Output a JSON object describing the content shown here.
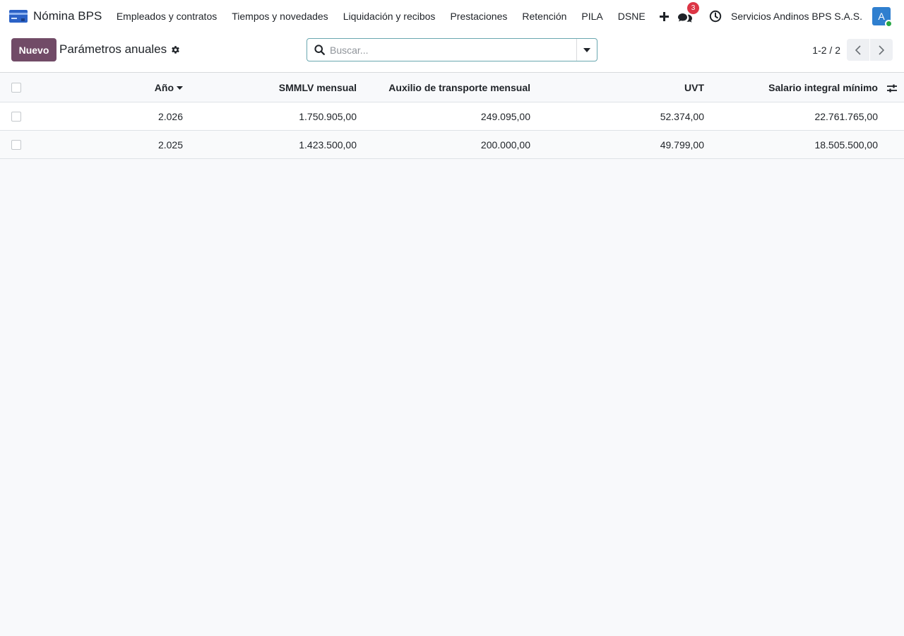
{
  "navbar": {
    "app_name": "Nómina BPS",
    "app_icon": "app-card-icon",
    "menu": [
      {
        "label": "Empleados y contratos"
      },
      {
        "label": "Tiempos y novedades"
      },
      {
        "label": "Liquidación y recibos"
      },
      {
        "label": "Prestaciones"
      },
      {
        "label": "Retención"
      },
      {
        "label": "PILA"
      },
      {
        "label": "DSNE"
      }
    ],
    "plus_icon": "plus-icon",
    "chat_icon": "chat-bubbles-icon",
    "chat_badge": "3",
    "clock_icon": "clock-icon",
    "company": "Servicios Andinos BPS S.A.S.",
    "avatar_initial": "A",
    "avatar_color": "#2f7fcf",
    "presence_color": "#28a745"
  },
  "control": {
    "new_label": "Nuevo",
    "new_color": "#714b67",
    "title": "Parámetros anuales",
    "search_placeholder": "Buscar...",
    "pager_value": "1-2 / 2"
  },
  "table": {
    "columns": [
      "Año",
      "SMMLV mensual",
      "Auxilio de transporte mensual",
      "UVT",
      "Salario integral mínimo"
    ],
    "sorted_column": "Año",
    "sort_direction": "descending",
    "rows": [
      {
        "anio": "2.026",
        "smmlv": "1.750.905,00",
        "auxilio": "249.095,00",
        "uvt": "52.374,00",
        "salario_integral": "22.761.765,00"
      },
      {
        "anio": "2.025",
        "smmlv": "1.423.500,00",
        "auxilio": "200.000,00",
        "uvt": "49.799,00",
        "salario_integral": "18.505.500,00"
      }
    ]
  }
}
